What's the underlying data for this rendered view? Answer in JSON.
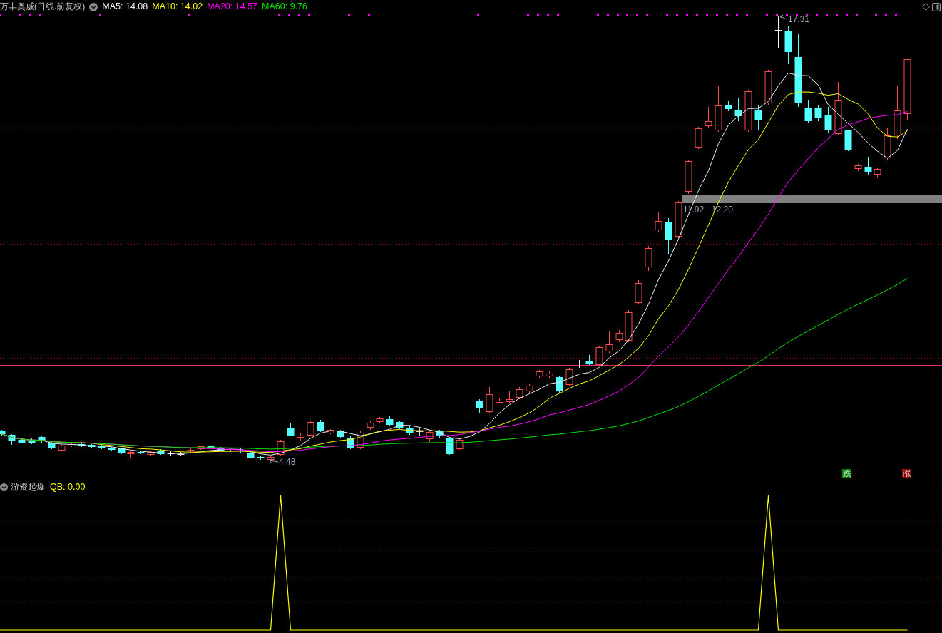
{
  "main_chart": {
    "title": "万丰奥威(日线.前复权)",
    "indicators": [
      {
        "label": "MA5: 14.08",
        "color": "#f0f0f0"
      },
      {
        "label": "MA10: 14.02",
        "color": "#ffff00"
      },
      {
        "label": "MA20: 14.57",
        "color": "#ff00ff"
      },
      {
        "label": "MA60: 9.76",
        "color": "#00e600"
      }
    ],
    "high_label": "17.31",
    "low_label": "4.48",
    "price_band": {
      "label": "11.92 - 12.20"
    },
    "tags": [
      {
        "text": "跌",
        "color": "#008000"
      },
      {
        "text": "涨",
        "color": "#800000"
      }
    ]
  },
  "sub_chart": {
    "title": "游资起爆",
    "readout": "QB: 0.00"
  }
}
